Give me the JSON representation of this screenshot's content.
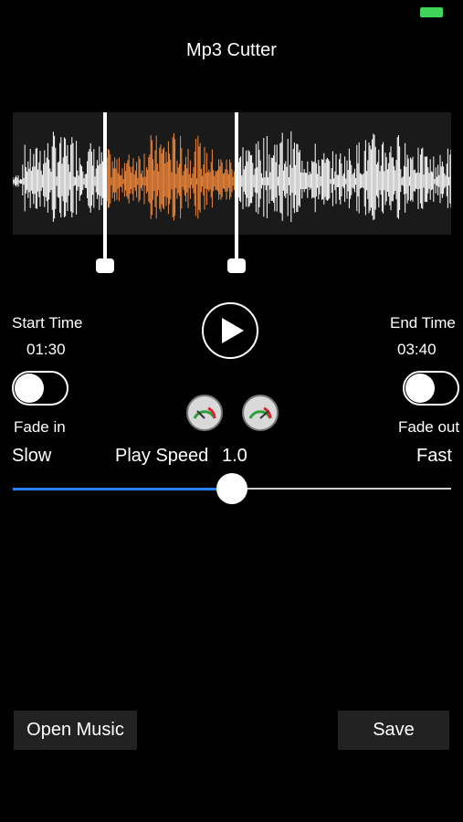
{
  "header": {
    "title": "Mp3 Cutter"
  },
  "status": {
    "battery_color": "#3fd45a"
  },
  "waveform": {
    "selection_color": "#f0873a",
    "base_color": "#ffffff",
    "start_fraction": 0.21,
    "end_fraction": 0.51
  },
  "controls": {
    "start_label": "Start Time",
    "start_value": "01:30",
    "end_label": "End Time",
    "end_value": "03:40",
    "fade_in_label": "Fade in",
    "fade_out_label": "Fade out",
    "fade_in_on": false,
    "fade_out_on": false,
    "play_icon": "play-icon"
  },
  "speed": {
    "slow_label": "Slow",
    "fast_label": "Fast",
    "play_speed_label": "Play Speed",
    "play_speed_value": "1.0",
    "slider_fraction": 0.5,
    "slow_gauge_icon": "slow-gauge-icon",
    "fast_gauge_icon": "fast-gauge-icon",
    "accent": "#2a7fff"
  },
  "footer": {
    "open_label": "Open Music",
    "save_label": "Save"
  }
}
